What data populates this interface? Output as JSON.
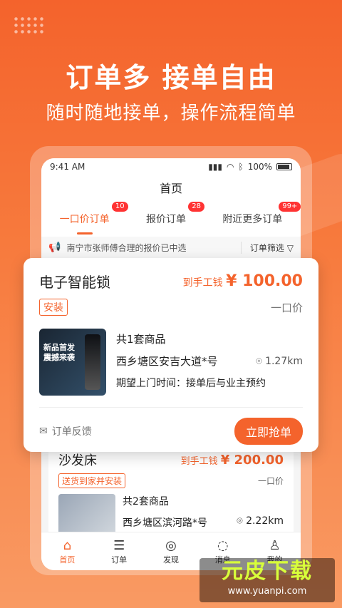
{
  "hero": {
    "title": "订单多 接单自由",
    "subtitle": "随时随地接单，操作流程简单"
  },
  "statusbar": {
    "time": "9:41 AM",
    "battery": "100%"
  },
  "page_title": "首页",
  "tabs": [
    {
      "label": "一口价订单",
      "badge": "10"
    },
    {
      "label": "报价订单",
      "badge": "28"
    },
    {
      "label": "附近更多订单",
      "badge": "99+"
    }
  ],
  "notice": {
    "text": "南宁市张师傅合理的报价已中选",
    "filter_label": "订单筛选"
  },
  "order_main": {
    "title": "电子智能锁",
    "price_label": "到手工钱",
    "price": "¥ 100.00",
    "tag": "安装",
    "type": "一口价",
    "image_text_1": "新品首发",
    "image_text_2": "震撼来袭",
    "count": "共1套商品",
    "address": "西乡塘区安吉大道*号",
    "distance": "1.27km",
    "expect": "期望上门时间：接单后与业主预约",
    "feedback_label": "订单反馈",
    "grab_label": "立即抢单"
  },
  "order_second": {
    "title": "沙发床",
    "price_label": "到手工钱",
    "price": "¥ 200.00",
    "tag": "送货到家并安装",
    "type": "一口价",
    "count": "共2套商品",
    "address": "西乡塘区滨河路*号",
    "distance": "2.22km"
  },
  "bottom_nav": [
    {
      "label": "首页",
      "icon": "home-icon"
    },
    {
      "label": "订单",
      "icon": "order-icon"
    },
    {
      "label": "发现",
      "icon": "compass-icon"
    },
    {
      "label": "消息",
      "icon": "message-icon"
    },
    {
      "label": "我的",
      "icon": "user-icon"
    }
  ],
  "watermark": {
    "main": "元皮下载",
    "url": "www.yuanpi.com"
  },
  "colors": {
    "accent": "#f4632c",
    "badge": "#ff3333"
  }
}
